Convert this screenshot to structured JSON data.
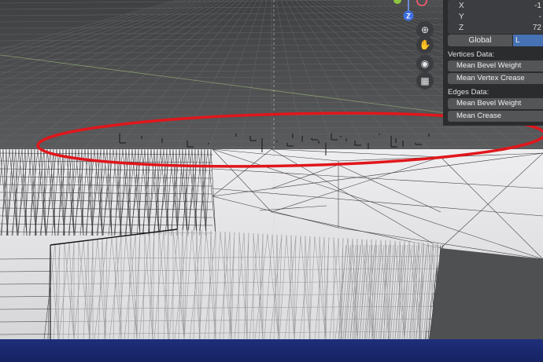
{
  "transform": {
    "rows": [
      {
        "axis": "X",
        "value": "-1"
      },
      {
        "axis": "Y",
        "value": "-"
      },
      {
        "axis": "Z",
        "value": "72"
      }
    ],
    "global_label": "Global",
    "local_label": "L"
  },
  "vertices_data": {
    "title": "Vertices Data:",
    "bevel_weight": "Mean Bevel Weight",
    "vertex_crease": "Mean Vertex Crease"
  },
  "edges_data": {
    "title": "Edges Data:",
    "bevel_weight": "Mean Bevel Weight",
    "crease": "Mean Crease"
  },
  "gizmo": {
    "axis_z": "Z"
  },
  "icons": [
    "zoom-icon",
    "pan-hand-icon",
    "camera-icon",
    "grid-view-icon"
  ],
  "colors": {
    "highlight_circle": "#e0161b",
    "local_active": "#4772b3",
    "panel_bg": "#2b2c2e",
    "viewport_grid": "#5f5f60",
    "mesh_face": "#e8e8ea"
  }
}
